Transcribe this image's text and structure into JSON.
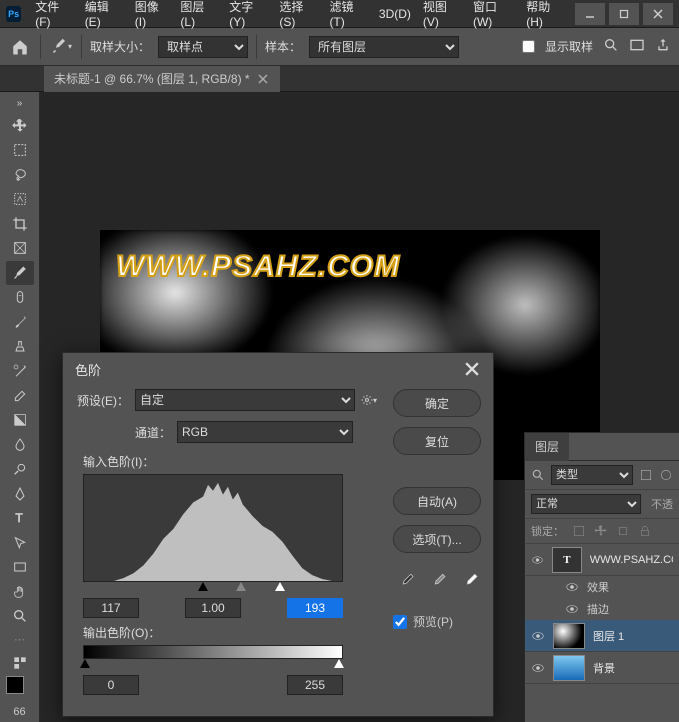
{
  "menubar": {
    "items": [
      "文件(F)",
      "编辑(E)",
      "图像(I)",
      "图层(L)",
      "文字(Y)",
      "选择(S)",
      "滤镜(T)",
      "3D(D)",
      "视图(V)",
      "窗口(W)",
      "帮助(H)"
    ]
  },
  "optionsbar": {
    "sample_size_label": "取样大小：",
    "sample_size_select": "取样点",
    "sample_label": "样本：",
    "sample_select": "所有图层",
    "show_ring": "显示取样"
  },
  "doc_tab": {
    "title": "未标题-1 @ 66.7% (图层 1, RGB/8) *"
  },
  "canvas": {
    "watermark": "WWW.PSAHZ.COM"
  },
  "toolbar": {
    "zoom": "66"
  },
  "levels_dialog": {
    "title": "色阶",
    "preset_label": "预设(E)：",
    "preset_value": "自定",
    "channel_label": "通道：",
    "channel_value": "RGB",
    "input_label": "输入色阶(I)：",
    "output_label": "输出色阶(O)：",
    "input_black": "117",
    "input_gamma": "1.00",
    "input_white": "193",
    "output_black": "0",
    "output_white": "255",
    "btn_ok": "确定",
    "btn_reset": "复位",
    "btn_auto": "自动(A)",
    "btn_options": "选项(T)...",
    "preview_label": "预览(P)"
  },
  "layers_panel": {
    "tab": "图层",
    "kind_label": "类型",
    "blend_mode": "正常",
    "opacity_label": "不透",
    "lock_label": "锁定：",
    "layers": [
      {
        "name": "WWW.PSAHZ.CO",
        "type": "text"
      },
      {
        "name": "效果",
        "type": "effect"
      },
      {
        "name": "描边",
        "type": "effect"
      },
      {
        "name": "图层 1",
        "type": "raster"
      },
      {
        "name": "背景",
        "type": "background"
      }
    ]
  }
}
